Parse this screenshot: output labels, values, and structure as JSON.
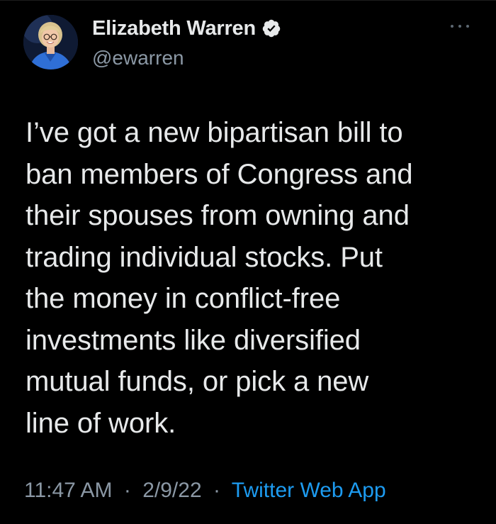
{
  "author": {
    "display_name": "Elizabeth Warren",
    "handle": "@ewarren",
    "verified": true,
    "avatar_icon": "profile-photo",
    "verified_icon": "verified-badge-icon"
  },
  "menu": {
    "icon": "more-horizontal-icon"
  },
  "tweet": {
    "text": "I’ve got a new bipartisan bill to\nban members of Congress and\ntheir spouses from owning and\ntrading individual stocks. Put\nthe money in conflict-free\ninvestments like diversified\nmutual funds, or pick a new\nline of work."
  },
  "meta": {
    "time": "11:47 AM",
    "separator": "·",
    "date": "2/9/22",
    "source": "Twitter Web App"
  },
  "colors": {
    "background": "#000000",
    "text_primary": "#e7e9ea",
    "text_secondary": "#8b98a5",
    "link": "#1d9bf0"
  }
}
